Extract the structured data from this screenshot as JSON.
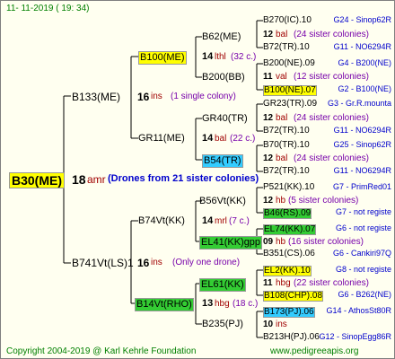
{
  "header": {
    "date": "11-  11-2019  (  19:  34)"
  },
  "footer": {
    "copyright": "Copyright 2004-2019 @ Karl Kehrle Foundation",
    "site": "www.pedigreeapis.org"
  },
  "tree": {
    "root": {
      "name": "B30(ME)",
      "num": "18",
      "sire": "amr",
      "note": "(Drones from 21 sister colonies)"
    },
    "g1a": {
      "name": "B133(ME)",
      "num": "16",
      "sire": "ins",
      "note": "(1 single colony)"
    },
    "g1b": {
      "name": "B741Vt(LS)1",
      "num": "16",
      "sire": "ins",
      "note": "(Only one drone)"
    },
    "g2a": {
      "name": "B100(ME)",
      "num": "14",
      "sire": "lthl",
      "note": "(32 c.)"
    },
    "g2b": {
      "name": "GR11(ME)",
      "num": "14",
      "sire": "bal",
      "note": "(22 c.)"
    },
    "g2c": {
      "name": "B74Vt(KK)",
      "num": "14",
      "sire": "mrl",
      "note": "(7 c.)"
    },
    "g2d": {
      "name": "B14Vt(RHO)",
      "num": "13",
      "sire": "hbg",
      "note": "(18 c.)"
    },
    "g3": [
      {
        "name": "B62(ME)"
      },
      {
        "name": "B200(BB)"
      },
      {
        "name": "GR40(TR)"
      },
      {
        "name": "B54(TR)"
      },
      {
        "name": "B56Vt(KK)"
      },
      {
        "name": "EL41(KK)gpp"
      },
      {
        "name": "EL61(KK)"
      },
      {
        "name": "B235(PJ)"
      }
    ],
    "right": [
      {
        "text": "B270(IC).10",
        "code": "G24 - Sinop62R"
      },
      {
        "num": "12",
        "sire": "bal",
        "note": "(24 sister colonies)"
      },
      {
        "text": "B72(TR).10",
        "code": "G11 - NO6294R"
      },
      {
        "text": "B200(NE).09",
        "code": "G4 - B200(NE)"
      },
      {
        "num": "11",
        "sire": "val",
        "note": "(12 sister colonies)"
      },
      {
        "text": "B100(NE).07",
        "code": "G2 - B100(NE)"
      },
      {
        "text": "GR23(TR).09",
        "code": "G3 - Gr.R.mounta"
      },
      {
        "num": "12",
        "sire": "bal",
        "note": "(24 sister colonies)"
      },
      {
        "text": "B72(TR).10",
        "code": "G11 - NO6294R"
      },
      {
        "text": "B70(TR).10",
        "code": "G25 - Sinop62R"
      },
      {
        "num": "12",
        "sire": "bal",
        "note": "(24 sister colonies)"
      },
      {
        "text": "B72(TR).10",
        "code": "G11 - NO6294R"
      },
      {
        "text": "P521(KK).10",
        "code": "G7 - PrimRed01"
      },
      {
        "num": "12",
        "sire": "hb",
        "note": "(5 sister colonies)"
      },
      {
        "text": "B46(RS).09",
        "code": "G7 - not registe"
      },
      {
        "text": "EL74(KK).07",
        "code": "G6 - not registe"
      },
      {
        "num": "09",
        "sire": "hb",
        "note": "(16 sister colonies)"
      },
      {
        "text": "B351(CS).06",
        "code": "G6 - Cankiri97Q"
      },
      {
        "text": "EL2(KK).10",
        "code": "G8 - not registe"
      },
      {
        "num": "11",
        "sire": "hbg",
        "note": "(22 sister colonies)"
      },
      {
        "text": "B108(CHP).08",
        "code": "G6 - B262(NE)"
      },
      {
        "text": "B173(PJ).06",
        "code": "G14 - AthosSt80R"
      },
      {
        "num": "10",
        "sire": "ins",
        "note": ""
      },
      {
        "text": "B213H(PJ).06",
        "code": "G12 - SinopEgg86R"
      }
    ]
  }
}
